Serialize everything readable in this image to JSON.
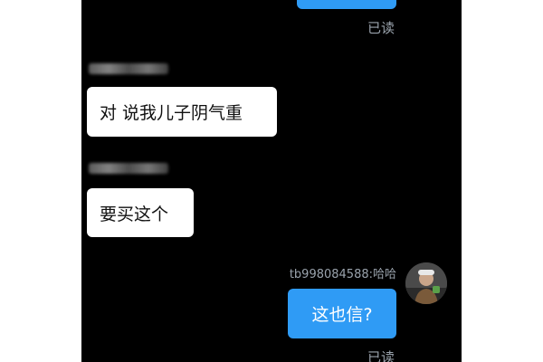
{
  "chat": {
    "messages": [
      {
        "side": "sent",
        "text": "",
        "read_label": "已读"
      },
      {
        "side": "received",
        "sender": "",
        "text": "对 说我儿子阴气重"
      },
      {
        "side": "received",
        "sender": "",
        "text": "要买这个"
      },
      {
        "side": "sent",
        "sender": "tb998084588:哈哈",
        "text": "这也信?",
        "read_label": "已读"
      }
    ]
  },
  "colors": {
    "background": "#000000",
    "sent_bubble": "#2f9bf5",
    "received_bubble": "#ffffff",
    "read_label": "#9aa3ad"
  },
  "icons": {
    "avatar": "user-avatar-photo"
  }
}
